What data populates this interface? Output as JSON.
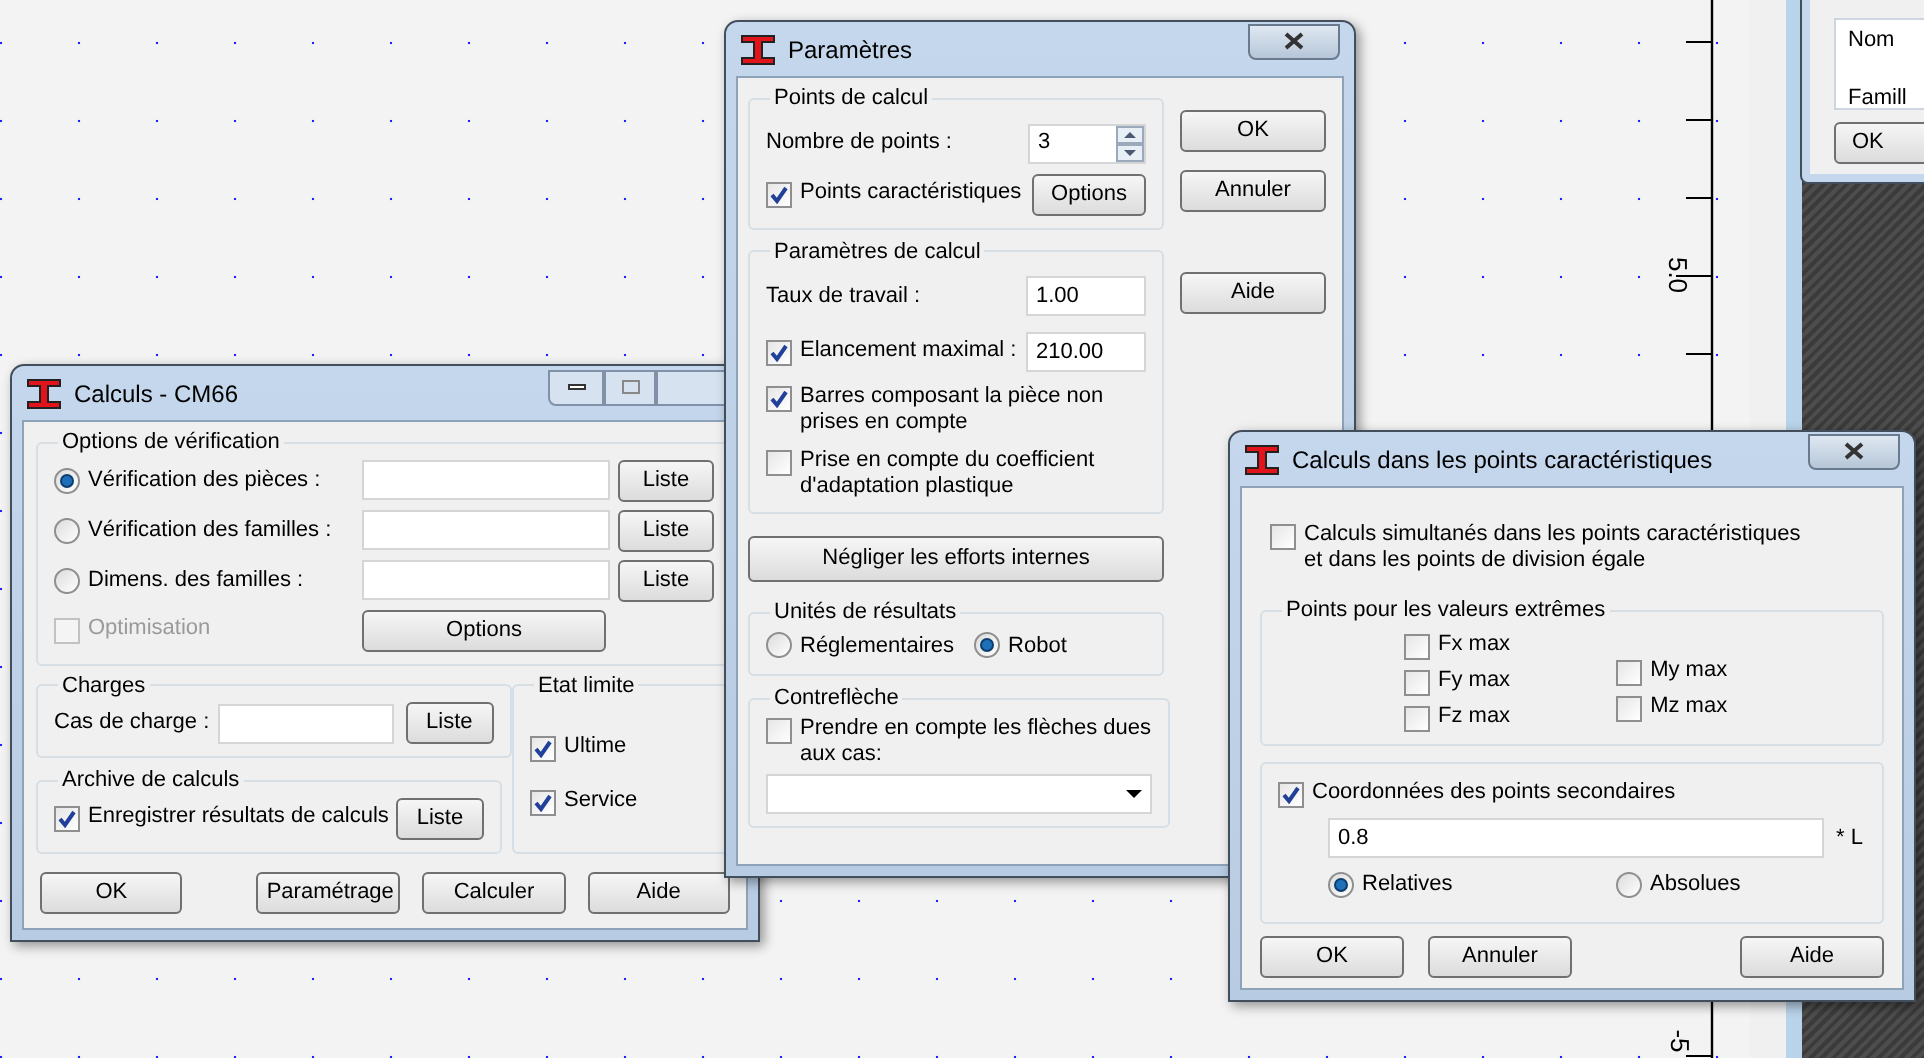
{
  "canvas": {
    "ruler_labels": [
      "5.0",
      "-5"
    ]
  },
  "background_window": {
    "labels": [
      "Nom",
      "Famill"
    ],
    "button": "OK"
  },
  "calculs_window": {
    "title": "Calculs - CM66",
    "verification": {
      "label": "Options de vérification",
      "options": [
        {
          "label": "Vérification des pièces :",
          "selected": true,
          "button": "Liste"
        },
        {
          "label": "Vérification des familles :",
          "selected": false,
          "button": "Liste"
        },
        {
          "label": "Dimens. des familles :",
          "selected": false,
          "button": "Liste"
        }
      ],
      "optimisation": {
        "label": "Optimisation",
        "checked": false,
        "disabled": true
      },
      "options_button": "Options"
    },
    "charges": {
      "label": "Charges",
      "field_label": "Cas de charge :",
      "button": "Liste"
    },
    "archive": {
      "label": "Archive de calculs",
      "checkbox": {
        "label": "Enregistrer résultats de calculs",
        "checked": true
      },
      "button": "Liste"
    },
    "etat_limite": {
      "label": "Etat limite",
      "items": [
        {
          "label": "Ultime",
          "checked": true
        },
        {
          "label": "Service",
          "checked": true
        }
      ]
    },
    "buttons": [
      "OK",
      "Paramétrage",
      "Calculer",
      "Aide"
    ]
  },
  "parametres_window": {
    "title": "Paramètres",
    "points": {
      "label": "Points de calcul",
      "count_label": "Nombre de points :",
      "count": "3",
      "checkbox": {
        "label": "Points caractéristiques",
        "checked": true
      },
      "button": "Options"
    },
    "calc": {
      "label": "Paramètres de calcul",
      "taux_label": "Taux de travail :",
      "taux": "1.00",
      "elancement": {
        "label": "Elancement maximal :",
        "checked": true,
        "value": "210.00"
      },
      "checkboxes": [
        {
          "label": "Barres composant la pièce non\nprises en compte",
          "checked": true
        },
        {
          "label": "Prise en compte du coefficient\nd'adaptation plastique",
          "checked": false
        }
      ]
    },
    "negliger_button": "Négliger les efforts internes",
    "unites": {
      "label": "Unités de résultats",
      "options": [
        {
          "label": "Réglementaires",
          "selected": false
        },
        {
          "label": "Robot",
          "selected": true
        }
      ]
    },
    "contrefleche": {
      "label": "Contreflèche",
      "checkbox": {
        "label": "Prendre en compte les flèches dues\naux cas:",
        "checked": false
      }
    },
    "buttons": [
      "OK",
      "Annuler",
      "Aide"
    ]
  },
  "points_window": {
    "title": "Calculs dans les points caractéristiques",
    "simultaneous": {
      "label": "Calculs simultanés dans les points caractéristiques\net dans les points de division égale",
      "checked": false
    },
    "extremes": {
      "label": "Points pour les valeurs extrêmes",
      "columns": [
        {
          "items": [
            {
              "label": "Fx max",
              "checked": false
            },
            {
              "label": "Fy max",
              "checked": false
            },
            {
              "label": "Fz max",
              "checked": false
            }
          ]
        },
        {
          "items": [
            {
              "label": "My max",
              "checked": false
            },
            {
              "label": "Mz max",
              "checked": false
            }
          ]
        }
      ]
    },
    "secondary": {
      "label": "Coordonnées des points secondaires",
      "checked": true,
      "value": "0.8",
      "suffix": "* L",
      "options": [
        {
          "label": "Relatives",
          "selected": true
        },
        {
          "label": "Absolues",
          "selected": false
        }
      ]
    },
    "buttons": [
      "OK",
      "Annuler",
      "Aide"
    ]
  }
}
